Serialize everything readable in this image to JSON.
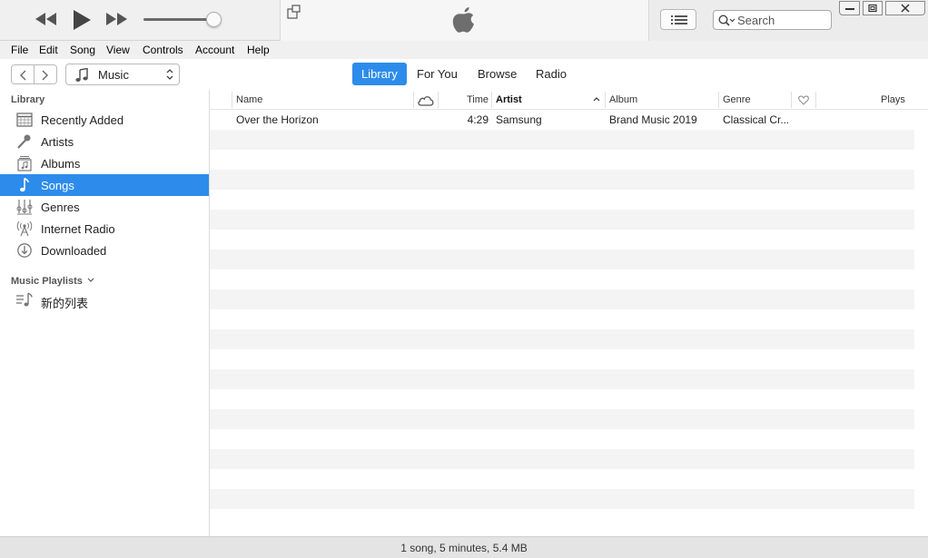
{
  "search": {
    "placeholder": "Search"
  },
  "menu": [
    "File",
    "Edit",
    "Song",
    "View",
    "Controls",
    "Account",
    "Help"
  ],
  "media_selector": {
    "selected": "Music"
  },
  "tabs": [
    {
      "label": "Library",
      "active": true
    },
    {
      "label": "For You",
      "active": false
    },
    {
      "label": "Browse",
      "active": false
    },
    {
      "label": "Radio",
      "active": false
    }
  ],
  "sidebar": {
    "library_heading": "Library",
    "items": [
      {
        "label": "Recently Added",
        "icon": "recently-added-icon",
        "selected": false
      },
      {
        "label": "Artists",
        "icon": "microphone-icon",
        "selected": false
      },
      {
        "label": "Albums",
        "icon": "album-icon",
        "selected": false
      },
      {
        "label": "Songs",
        "icon": "music-note-icon",
        "selected": true
      },
      {
        "label": "Genres",
        "icon": "genres-icon",
        "selected": false
      },
      {
        "label": "Internet Radio",
        "icon": "radio-antenna-icon",
        "selected": false
      },
      {
        "label": "Downloaded",
        "icon": "download-icon",
        "selected": false
      }
    ],
    "playlists_heading": "Music Playlists",
    "playlists": [
      {
        "label": "新的列表",
        "icon": "playlist-icon"
      }
    ]
  },
  "table": {
    "columns": {
      "name": "Name",
      "time": "Time",
      "artist": "Artist",
      "album": "Album",
      "genre": "Genre",
      "plays": "Plays"
    },
    "sorted_by": "Artist",
    "rows": [
      {
        "name": "Over the Horizon",
        "time": "4:29",
        "artist": "Samsung",
        "album": "Brand Music 2019",
        "genre": "Classical Cr..."
      }
    ]
  },
  "status": "1 song, 5 minutes, 5.4 MB",
  "colors": {
    "accent": "#2d8ceb",
    "row_alt": "#f4f4f4"
  }
}
